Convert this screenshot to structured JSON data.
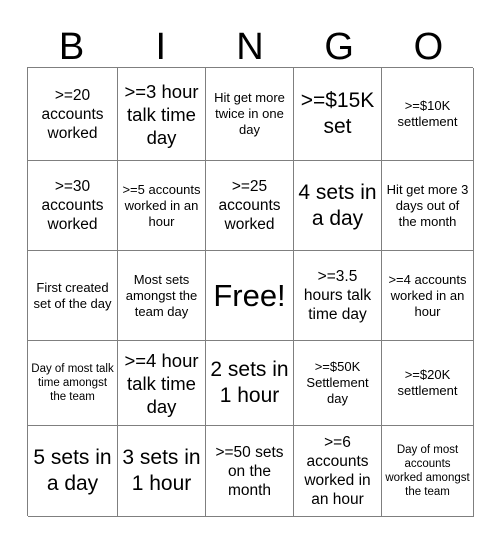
{
  "card": {
    "title": "BINGO",
    "headers": [
      "B",
      "I",
      "N",
      "G",
      "O"
    ],
    "free_space_label": "Free!",
    "grid_line_color": "#7f7f7f",
    "background_color": "#ffffff",
    "text_color": "#000000",
    "rows": [
      [
        {
          "text": "&gt;=20 accounts worked",
          "size": "md"
        },
        {
          "text": "&gt;=3 hour talk time day",
          "size": "lg"
        },
        {
          "text": "Hit get more twice in one day",
          "size": "sm"
        },
        {
          "text": "&gt;=$15K set",
          "size": "xl"
        },
        {
          "text": "&gt;=$10K settlement",
          "size": "sm"
        }
      ],
      [
        {
          "text": "&gt;=30 accounts worked",
          "size": "md"
        },
        {
          "text": "&gt;=5 accounts worked in an hour",
          "size": "sm"
        },
        {
          "text": "&gt;=25 accounts worked",
          "size": "md"
        },
        {
          "text": "4 sets in a day",
          "size": "xl"
        },
        {
          "text": "Hit get more 3 days out of the month",
          "size": "sm"
        }
      ],
      [
        {
          "text": "First created set of the day",
          "size": "sm"
        },
        {
          "text": "Most sets amongst the team day",
          "size": "sm"
        },
        {
          "text": "Free!",
          "size": "free"
        },
        {
          "text": "&gt;=3.5 hours talk time day",
          "size": "md"
        },
        {
          "text": "&gt;=4 accounts worked in an hour",
          "size": "sm"
        }
      ],
      [
        {
          "text": "Day of most talk time amongst the team",
          "size": "xs"
        },
        {
          "text": "&gt;=4 hour talk time day",
          "size": "lg"
        },
        {
          "text": "2 sets in 1 hour",
          "size": "xl"
        },
        {
          "text": "&gt;=$50K Settlement day",
          "size": "sm"
        },
        {
          "text": "&gt;=$20K settlement",
          "size": "sm"
        }
      ],
      [
        {
          "text": "5 sets in a day",
          "size": "xl"
        },
        {
          "text": "3 sets in 1 hour",
          "size": "xl"
        },
        {
          "text": "&gt;=50 sets on the month",
          "size": "md"
        },
        {
          "text": "&gt;=6 accounts worked in an hour",
          "size": "md"
        },
        {
          "text": "Day of most accounts worked amongst the team",
          "size": "xs"
        }
      ]
    ]
  }
}
